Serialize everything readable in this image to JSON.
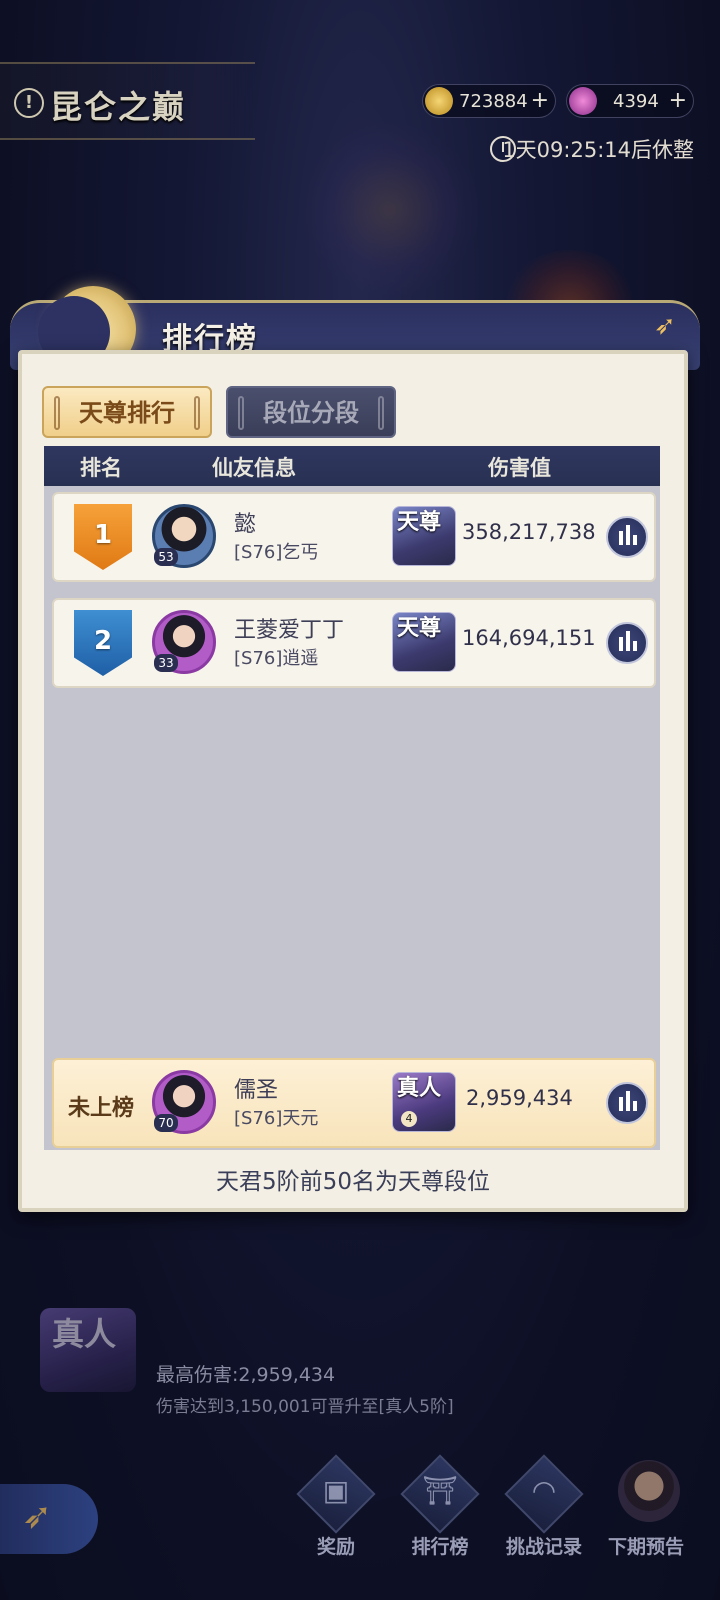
{
  "header": {
    "title": "昆仑之巅",
    "currencies": [
      {
        "name": "gold-coin-icon",
        "value": "723884",
        "color": "#e2b64a"
      },
      {
        "name": "purple-flame-icon",
        "value": "4394",
        "color": "#c45bb8"
      }
    ],
    "timer": "1天09:25:14后休整"
  },
  "panel": {
    "title": "排行榜",
    "tabs": [
      {
        "label": "天尊排行",
        "active": true
      },
      {
        "label": "段位分段",
        "active": false
      }
    ],
    "columns": [
      "排名",
      "仙友信息",
      "伤害值"
    ],
    "rows": [
      {
        "rank": "1",
        "level": "53",
        "name": "懿",
        "guild": "[S76]乞丐",
        "tier": "天尊",
        "damage": "358,217,738"
      },
      {
        "rank": "2",
        "level": "33",
        "name": "王菱爱丁丁",
        "guild": "[S76]逍遥",
        "tier": "天尊",
        "damage": "164,694,151"
      }
    ],
    "me": {
      "rank_label": "未上榜",
      "level": "70",
      "name": "儒圣",
      "guild": "[S76]天元",
      "tier": "真人",
      "tier_sub": "4",
      "damage": "2,959,434"
    },
    "footer": "天君5阶前50名为天尊段位"
  },
  "best": {
    "tier": "真人",
    "tier_sub": "4",
    "max_damage": "最高伤害:2,959,434",
    "hint": "伤害达到3,150,001可晋升至[真人5阶]"
  },
  "nav": [
    {
      "label": "奖励",
      "icon": "reward-chest-icon"
    },
    {
      "label": "排行榜",
      "icon": "ranking-icon"
    },
    {
      "label": "挑战记录",
      "icon": "record-icon"
    },
    {
      "label": "下期预告",
      "icon": "preview-portrait-icon"
    }
  ]
}
